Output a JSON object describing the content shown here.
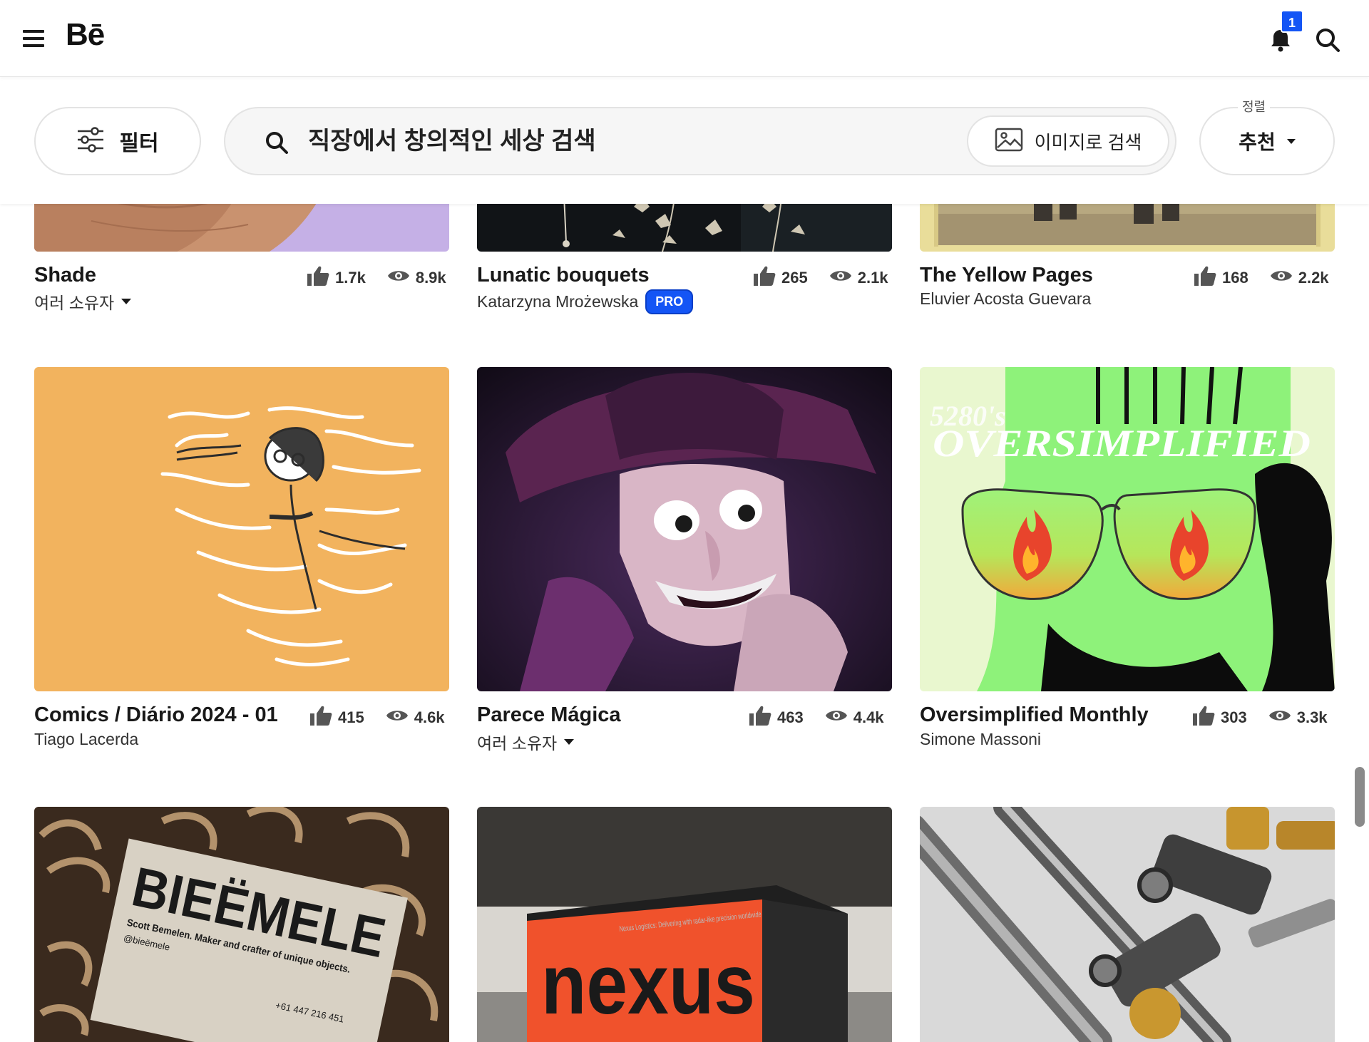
{
  "header": {
    "logo": "Bē",
    "notification_count": "1"
  },
  "filters": {
    "filter_label": "필터",
    "search_value": "직장에서 창의적인 세상 검색",
    "image_search_label": "이미지로 검색",
    "sort_caption": "정렬",
    "sort_value": "추천"
  },
  "projects": [
    {
      "title": "Shade",
      "owner": "여러 소유자",
      "multiple_owners": true,
      "likes": "1.7k",
      "views": "8.9k"
    },
    {
      "title": "Lunatic bouquets",
      "owner": "Katarzyna Mrożewska",
      "pro": "PRO",
      "likes": "265",
      "views": "2.1k"
    },
    {
      "title": "The Yellow Pages",
      "owner": "Eluvier Acosta Guevara",
      "likes": "168",
      "views": "2.2k"
    },
    {
      "title": "Comics / Diário 2024 - 01",
      "owner": "Tiago Lacerda",
      "likes": "415",
      "views": "4.6k"
    },
    {
      "title": "Parece Mágica",
      "owner": "여러 소유자",
      "multiple_owners": true,
      "likes": "463",
      "views": "4.4k"
    },
    {
      "title": "Oversimplified Monthly",
      "owner": "Simone Massoni",
      "likes": "303",
      "views": "3.3k"
    }
  ],
  "artwork_text": {
    "oversimplified_small": "5280's",
    "oversimplified_big": "OVERSIMPLIFIED",
    "card_brand": "BIEËMELE",
    "card_line1": "Scott Bemelen. Maker and crafter of unique objects.",
    "card_line2": "@bieëmele",
    "card_phone": "+61 447 216 451",
    "box_brand": "nexus",
    "box_tagline": "Nexus Logistics: Delivering with radar-like precision worldwide"
  }
}
